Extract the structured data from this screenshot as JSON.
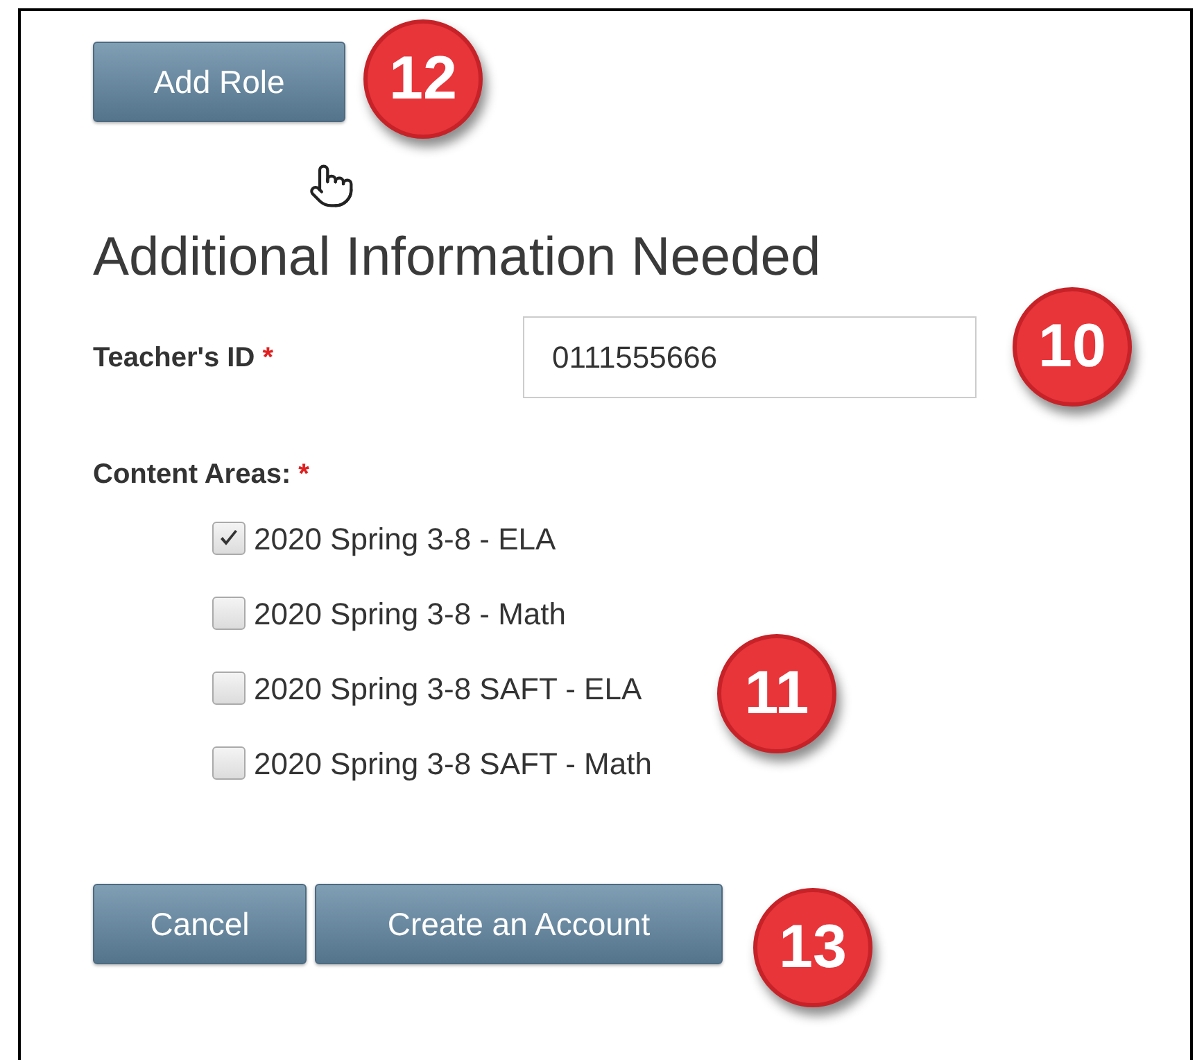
{
  "add_role_button": "Add Role",
  "heading": "Additional Information Needed",
  "teacher_id": {
    "label": "Teacher's ID",
    "required_mark": "*",
    "value": "0111555666"
  },
  "content_areas": {
    "label": "Content Areas:",
    "required_mark": "*",
    "options": [
      {
        "label": "2020 Spring 3-8 - ELA",
        "checked": true
      },
      {
        "label": "2020 Spring 3-8 - Math",
        "checked": false
      },
      {
        "label": "2020 Spring 3-8 SAFT - ELA",
        "checked": false
      },
      {
        "label": "2020 Spring 3-8 SAFT - Math",
        "checked": false
      }
    ]
  },
  "buttons": [
    "Cancel",
    "Create an Account"
  ],
  "callouts": [
    "12",
    "10",
    "11",
    "13"
  ]
}
